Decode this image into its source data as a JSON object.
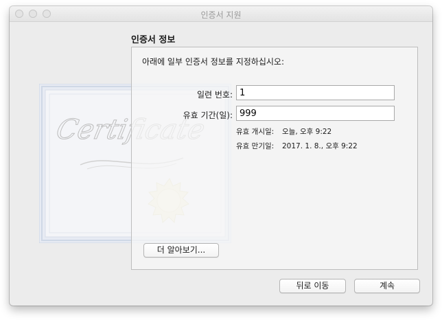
{
  "window": {
    "title": "인증서 지원"
  },
  "section": {
    "title": "인증서 정보",
    "instructions": "아래에 일부 인증서 정보를 지정하십시오:"
  },
  "form": {
    "serial_label": "일련 번호:",
    "serial_value": "1",
    "validity_label": "유효 기간(일):",
    "validity_value": "999",
    "start_label": "유효 개시일:",
    "start_value": "오늘, 오후 9:22",
    "end_label": "유효 만기일:",
    "end_value": "2017. 1. 8., 오후 9:22"
  },
  "buttons": {
    "learn_more": "더 알아보기...",
    "back": "뒤로 이동",
    "continue": "계속"
  },
  "art": {
    "certificate_word": "Certificate"
  }
}
